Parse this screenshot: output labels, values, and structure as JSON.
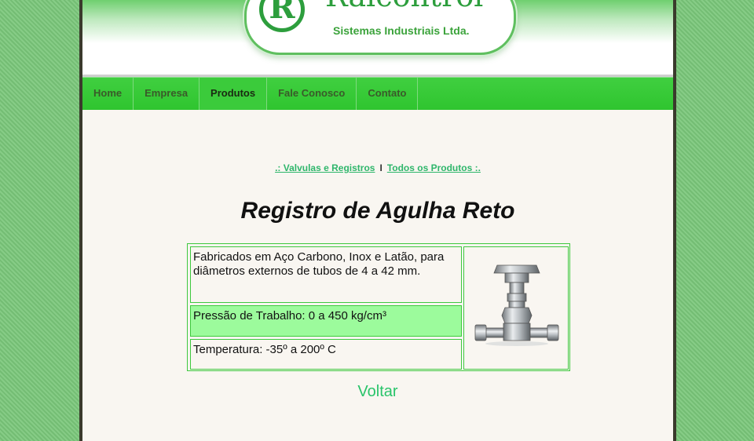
{
  "header": {
    "logo_mark": "R",
    "brand_name": "Ralcontrol",
    "tagline": "Sistemas Industriais Ltda."
  },
  "nav": {
    "items": [
      {
        "label": "Home"
      },
      {
        "label": "Empresa"
      },
      {
        "label": "Produtos"
      },
      {
        "label": "Fale Conosco"
      },
      {
        "label": "Contato"
      }
    ],
    "active": "Produtos"
  },
  "breadcrumb": {
    "link1": ".: Valvulas e Registros",
    "separator": "I",
    "link2": "Todos os Produtos :."
  },
  "product": {
    "title": "Registro de Agulha Reto",
    "description": "Fabricados em Aço Carbono, Inox e Latão, para diâmetros externos de tubos de 4 a 42 mm.",
    "pressure": "Pressão de Trabalho: 0 a 450 kg/cm³",
    "temperature": "Temperatura: -35º a 200º C",
    "image_icon": "needle-valve-image"
  },
  "back_link": "Voltar",
  "colors": {
    "nav_green": "#2fc52f",
    "link_green": "#2fb66b",
    "highlight_row": "#9cfb9c",
    "page_bg": "#f9f6f1"
  }
}
